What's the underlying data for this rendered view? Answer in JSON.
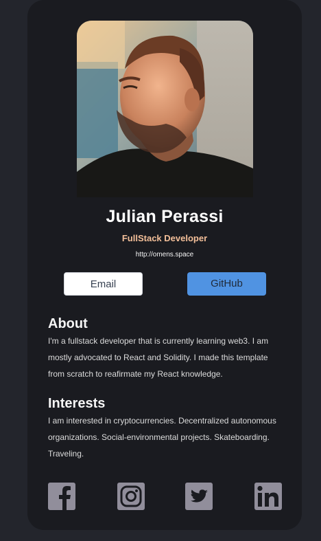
{
  "profile": {
    "name": "Julian Perassi",
    "role": "FullStack Developer",
    "website": "http://omens.space"
  },
  "buttons": {
    "email_label": "Email",
    "github_label": "GitHub"
  },
  "about": {
    "title": "About",
    "text": "I'm a fullstack developer that is currently learning web3. I am mostly advocated to React and Solidity. I made this template from scratch to reafirmate my React knowledge."
  },
  "interests": {
    "title": "Interests",
    "text": "I am interested in cryptocurrencies. Decentralized autonomous organizations. Social-environmental projects. Skateboarding. Traveling."
  },
  "social": [
    {
      "icon": "facebook-icon"
    },
    {
      "icon": "instagram-icon"
    },
    {
      "icon": "twitter-icon"
    },
    {
      "icon": "linkedin-icon"
    }
  ],
  "colors": {
    "page_background": "#23252c",
    "card_background": "#1a1b20",
    "role_accent": "#f3bf99",
    "github_button": "#5093e2",
    "social_icon": "#918e9b"
  }
}
